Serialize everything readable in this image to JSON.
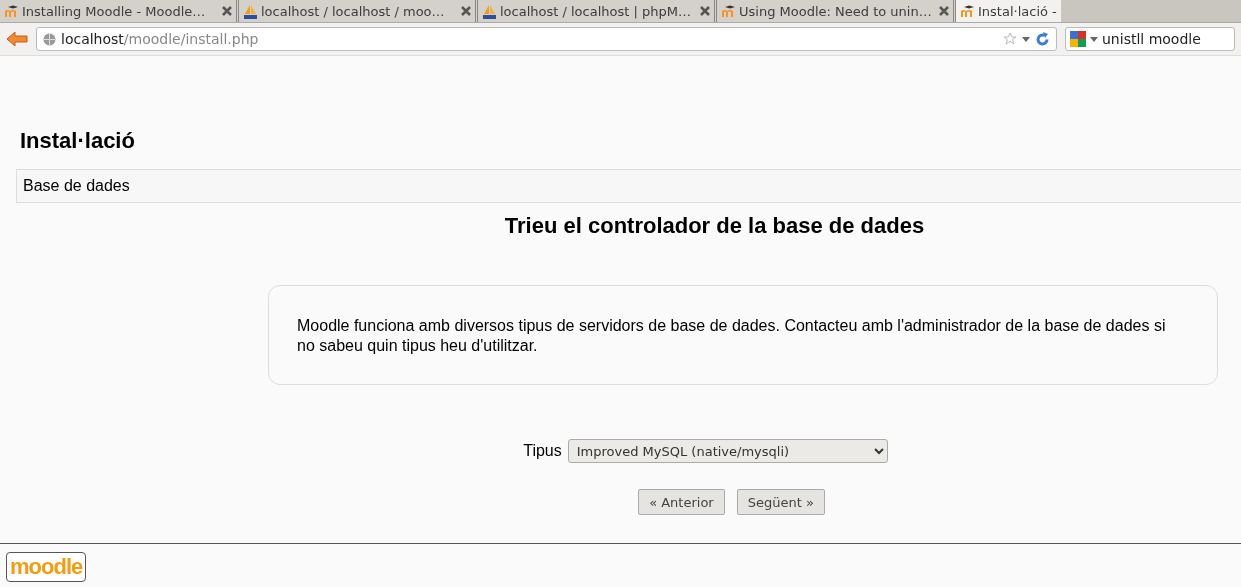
{
  "browser": {
    "tabs": [
      {
        "title": "Installing Moodle - Moodle…",
        "kind": "moodle",
        "selected": false
      },
      {
        "title": "localhost / localhost / moo…",
        "kind": "pma",
        "selected": false
      },
      {
        "title": "localhost / localhost | phpM…",
        "kind": "pma",
        "selected": false
      },
      {
        "title": "Using Moodle: Need to unin…",
        "kind": "moodle",
        "selected": false
      },
      {
        "title": "Instal·lació -",
        "kind": "moodle",
        "selected": true
      }
    ],
    "address": {
      "host": "localhost",
      "path": "/moodle/install.php"
    },
    "search": {
      "value": "unistll moodle"
    }
  },
  "page": {
    "heading": "Instal·lació",
    "section": "Base de dades",
    "title": "Trieu el controlador de la base de dades",
    "notice": "Moodle funciona amb diversos tipus de servidors de base de dades. Contacteu amb l'administrador de la base de dades si no sabeu quin tipus heu d'utilitzar.",
    "field": {
      "label": "Tipus",
      "value": "Improved MySQL (native/mysqli)"
    },
    "buttons": [
      "« Anterior",
      "Següent »"
    ],
    "logo": "moodle"
  }
}
